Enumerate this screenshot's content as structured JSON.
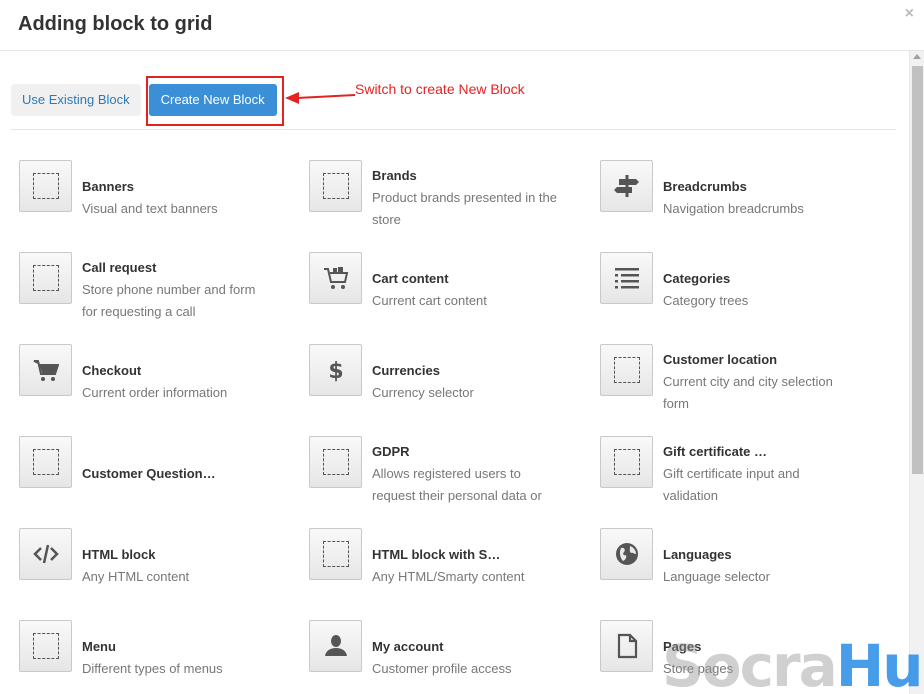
{
  "dialog": {
    "title": "Adding block to grid",
    "close_glyph": "×"
  },
  "tabs": {
    "existing_label": "Use Existing Block",
    "new_label": "Create New Block"
  },
  "annotation": {
    "text": "Switch to create New Block",
    "color": "#e32222"
  },
  "blocks": [
    {
      "title": "Banners",
      "desc": "Visual and text banners",
      "icon": "dashed-square-icon"
    },
    {
      "title": "Brands",
      "desc": "Product brands presented in the store",
      "icon": "dashed-square-icon"
    },
    {
      "title": "Breadcrumbs",
      "desc": "Navigation breadcrumbs",
      "icon": "signpost-icon"
    },
    {
      "title": "Call request",
      "desc": "Store phone number and form for requesting a call",
      "icon": "dashed-square-icon"
    },
    {
      "title": "Cart content",
      "desc": "Current cart content",
      "icon": "cart-full-icon"
    },
    {
      "title": "Categories",
      "desc": "Category trees",
      "icon": "list-icon"
    },
    {
      "title": "Checkout",
      "desc": "Current order information",
      "icon": "cart-icon"
    },
    {
      "title": "Currencies",
      "desc": "Currency selector",
      "icon": "dollar-icon"
    },
    {
      "title": "Customer location",
      "desc": "Current city and city selection form",
      "icon": "dashed-square-icon"
    },
    {
      "title": "Customer Question…",
      "desc": "",
      "icon": "dashed-square-icon"
    },
    {
      "title": "GDPR",
      "desc": "Allows registered users to request their personal data or",
      "icon": "dashed-square-icon"
    },
    {
      "title": "Gift certificate …",
      "desc": "Gift certificate input and validation",
      "icon": "dashed-square-icon"
    },
    {
      "title": "HTML block",
      "desc": "Any HTML content",
      "icon": "code-icon"
    },
    {
      "title": "HTML block with S…",
      "desc": "Any HTML/Smarty content",
      "icon": "dashed-square-icon"
    },
    {
      "title": "Languages",
      "desc": "Language selector",
      "icon": "globe-icon"
    },
    {
      "title": "Menu",
      "desc": "Different types of menus",
      "icon": "dashed-square-icon"
    },
    {
      "title": "My account",
      "desc": "Customer profile access",
      "icon": "user-icon"
    },
    {
      "title": "Pages",
      "desc": "Store pages",
      "icon": "page-icon"
    }
  ],
  "watermark": {
    "part1": "Socra",
    "part2": "Hub"
  },
  "colors": {
    "primary_button": "#3a8fd6",
    "link": "#2b7bb9",
    "annotation": "#e32222"
  }
}
